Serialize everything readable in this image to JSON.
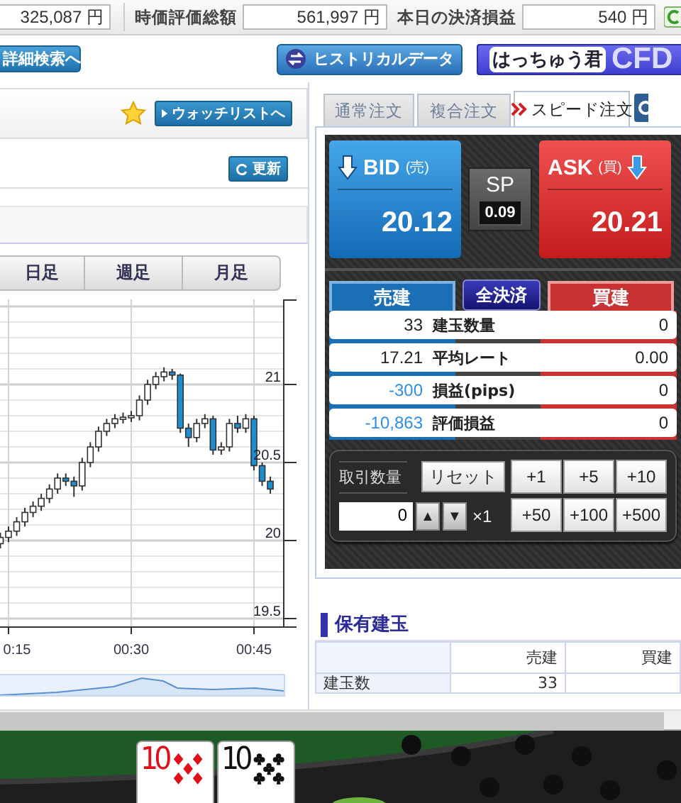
{
  "summary": {
    "fields": [
      {
        "value": "325,087 円"
      },
      {
        "label": "時価評価総額",
        "value": "561,997 円"
      },
      {
        "label": "本日の決済損益",
        "value": "540 円"
      }
    ]
  },
  "nav": {
    "detail_search_button": "詳細検索へ",
    "historical_button": "ヒストリカルデータ",
    "banner": {
      "logo": "はっちゅう君",
      "product": "CFD"
    }
  },
  "chart_panel": {
    "watchlist_button": "ウォッチリストへ",
    "refresh_button": "更新",
    "periods": [
      {
        "label": "日足",
        "selected": false
      },
      {
        "label": "週足",
        "selected": false
      },
      {
        "label": "月足",
        "selected": false
      }
    ],
    "chart_data": {
      "type": "candlestick",
      "x": [
        14,
        15,
        16,
        17,
        18,
        19,
        20,
        21,
        22,
        23,
        24,
        25,
        26,
        27,
        28,
        29,
        30,
        31,
        32,
        33,
        34,
        35,
        36,
        37,
        38,
        39,
        40,
        41,
        42,
        43,
        44,
        45,
        46,
        47
      ],
      "ohlc": [
        [
          19.98,
          20.05,
          19.95,
          20.02
        ],
        [
          20.02,
          20.09,
          19.99,
          20.06
        ],
        [
          20.06,
          20.15,
          20.03,
          20.12
        ],
        [
          20.12,
          20.21,
          20.09,
          20.18
        ],
        [
          20.18,
          20.25,
          20.15,
          20.22
        ],
        [
          20.22,
          20.3,
          20.19,
          20.27
        ],
        [
          20.27,
          20.36,
          20.24,
          20.33
        ],
        [
          20.33,
          20.43,
          20.3,
          20.4
        ],
        [
          20.4,
          20.43,
          20.35,
          20.38
        ],
        [
          20.38,
          20.41,
          20.28,
          20.35
        ],
        [
          20.35,
          20.53,
          20.32,
          20.5
        ],
        [
          20.5,
          20.63,
          20.47,
          20.6
        ],
        [
          20.6,
          20.73,
          20.57,
          20.7
        ],
        [
          20.7,
          20.78,
          20.67,
          20.75
        ],
        [
          20.75,
          20.81,
          20.72,
          20.78
        ],
        [
          20.78,
          20.82,
          20.75,
          20.79
        ],
        [
          20.79,
          20.83,
          20.76,
          20.8
        ],
        [
          20.8,
          20.93,
          20.77,
          20.9
        ],
        [
          20.9,
          21.03,
          20.87,
          21.0
        ],
        [
          21.0,
          21.08,
          20.97,
          21.05
        ],
        [
          21.05,
          21.11,
          21.02,
          21.08
        ],
        [
          21.08,
          21.1,
          21.03,
          21.06
        ],
        [
          21.06,
          21.07,
          20.69,
          20.72
        ],
        [
          20.72,
          20.75,
          20.6,
          20.66
        ],
        [
          20.66,
          20.78,
          20.63,
          20.75
        ],
        [
          20.75,
          20.81,
          20.72,
          20.78
        ],
        [
          20.78,
          20.8,
          20.55,
          20.58
        ],
        [
          20.58,
          20.63,
          20.55,
          20.6
        ],
        [
          20.6,
          20.78,
          20.57,
          20.75
        ],
        [
          20.75,
          20.8,
          20.69,
          20.72
        ],
        [
          20.72,
          20.81,
          20.69,
          20.78
        ],
        [
          20.78,
          20.8,
          20.45,
          20.48
        ],
        [
          20.48,
          20.5,
          20.35,
          20.38
        ],
        [
          20.38,
          20.41,
          20.3,
          20.33
        ]
      ],
      "xlim": [
        13.96,
        48.64
      ],
      "ylim": [
        19.45,
        21.5
      ],
      "grid": true,
      "yticks": [
        21,
        20.5,
        20,
        19.5
      ],
      "xticks": [
        {
          "value": 15,
          "label": "0:15"
        },
        {
          "value": 30,
          "label": "00:30"
        },
        {
          "value": 45,
          "label": "00:45"
        }
      ]
    }
  },
  "order_tabs": [
    {
      "label": "通常注文",
      "selected": false
    },
    {
      "label": "複合注文",
      "selected": false
    },
    {
      "label": "スピード注文",
      "selected": true
    }
  ],
  "quote": {
    "bid": {
      "label": "BID",
      "side": "(売)",
      "price": "20.12"
    },
    "spread": {
      "label": "SP",
      "value": "0.09"
    },
    "ask": {
      "label": "ASK",
      "side": "(買)",
      "price": "20.21"
    }
  },
  "position_summary": {
    "sell_header": "売建",
    "close_all_button": "全決済",
    "buy_header": "買建",
    "rows": [
      {
        "sell": "33",
        "label": "建玉数量",
        "buy": "0",
        "negative": false
      },
      {
        "sell": "17.21",
        "label": "平均レート",
        "buy": "0.00",
        "negative": false
      },
      {
        "sell": "-300",
        "label": "損益(pips)",
        "buy": "0",
        "negative": true
      },
      {
        "sell": "-10,863",
        "label": "評価損益",
        "buy": "0",
        "negative": true
      }
    ]
  },
  "quantity": {
    "label": "取引数量",
    "reset_button": "リセット",
    "value": "0",
    "up": "▲",
    "down": "▼",
    "multiplier": "×1",
    "increments": [
      "+1",
      "+5",
      "+10",
      "+50",
      "+100",
      "+500"
    ]
  },
  "holdings": {
    "title": "保有建玉",
    "columns": [
      "売建",
      "買建"
    ],
    "rows": [
      {
        "label": "建玉数",
        "sell": "33"
      }
    ]
  },
  "game_banner": {
    "cards": [
      {
        "rank": "10",
        "kind": "diamond"
      },
      {
        "rank": "10",
        "kind": "club"
      }
    ]
  }
}
